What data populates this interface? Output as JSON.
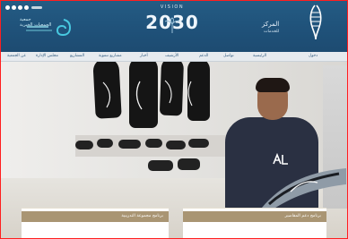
{
  "header": {
    "vision_label": "VISION",
    "vision_year": "2030",
    "left_org_name": "جمعية",
    "left_org_tagline": "الجمعيات الخيرية",
    "right_org_name": "المركز",
    "right_org_tagline": "للخدمات"
  },
  "nav": {
    "items": [
      {
        "label": "عن الجمعية"
      },
      {
        "label": "مجلس الإدارة"
      },
      {
        "label": "المشاريع"
      },
      {
        "label": "مشاريع تنموية"
      },
      {
        "label": "أخبار"
      },
      {
        "label": "الأرشيف"
      },
      {
        "label": "الدعم"
      },
      {
        "label": "تواصل"
      },
      {
        "label": "الرئيسية"
      },
      {
        "label": "دخول"
      }
    ]
  },
  "content": {
    "box1_label": "برنامج مجموعة التدريبية",
    "box2_label": "برنامج دعم المقاصير"
  },
  "colors": {
    "header": "#215781",
    "nav": "#e7ebef",
    "accent": "#a99573",
    "frame": "#ff1f1f"
  }
}
